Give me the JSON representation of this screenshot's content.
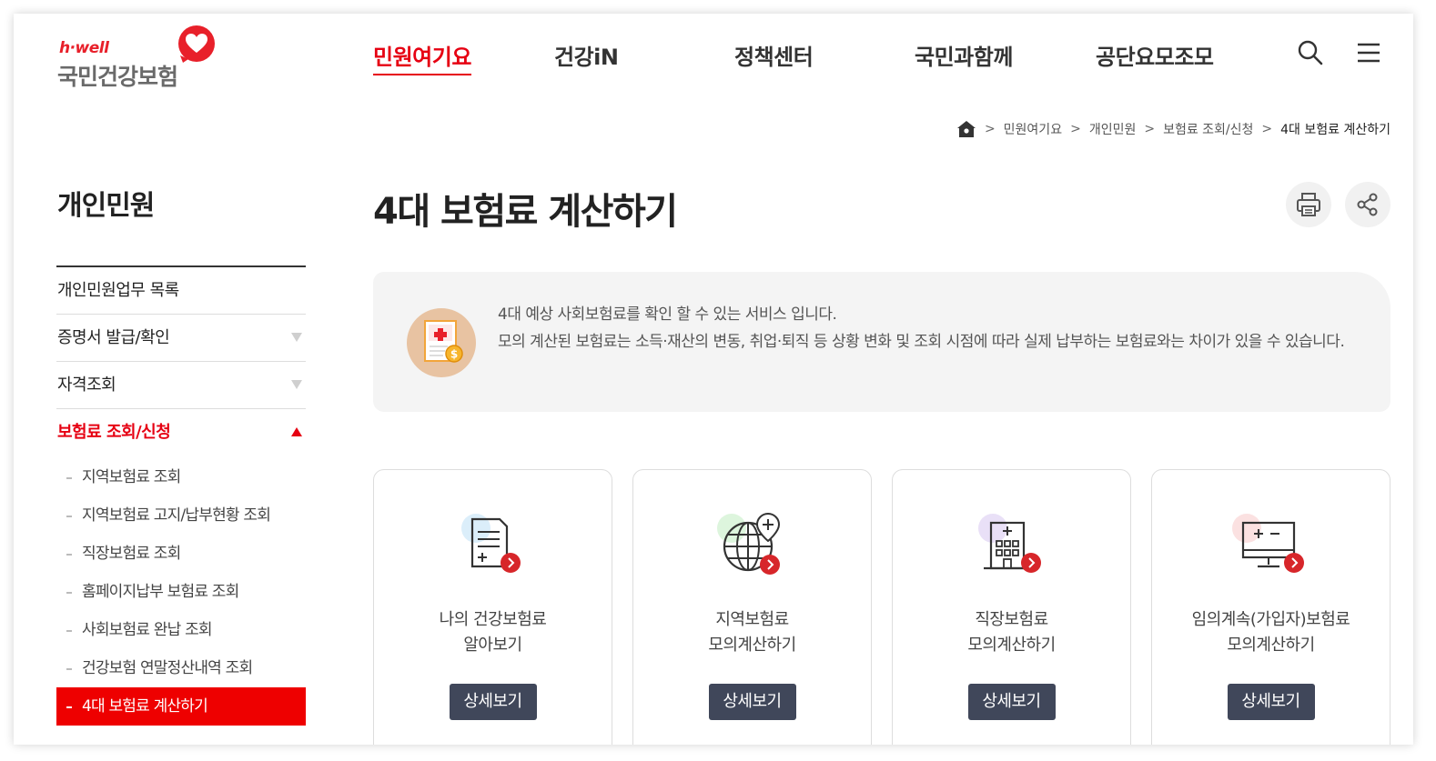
{
  "brand": {
    "tagline": "h·well",
    "name": "국민건강보험",
    "accent_color": "#e60012"
  },
  "gnb": [
    {
      "label": "민원여기요",
      "active": true
    },
    {
      "label": "건강iN",
      "active": false
    },
    {
      "label": "정책센터",
      "active": false
    },
    {
      "label": "국민과함께",
      "active": false
    },
    {
      "label": "공단요모조모",
      "active": false
    }
  ],
  "header_icons": [
    "search-icon",
    "menu-icon"
  ],
  "breadcrumb": {
    "home_icon": "home-icon",
    "items": [
      "민원여기요",
      "개인민원",
      "보험료 조회/신청",
      "4대 보험료 계산하기"
    ]
  },
  "lnb": {
    "title": "개인민원",
    "items": [
      {
        "label": "개인민원업무 목록",
        "arrow": "none"
      },
      {
        "label": "증명서 발급/확인",
        "arrow": "down"
      },
      {
        "label": "자격조회",
        "arrow": "down"
      },
      {
        "label": "보험료 조회/신청",
        "arrow": "up"
      }
    ],
    "sub_items": [
      {
        "label": "지역보험료 조회",
        "active": false
      },
      {
        "label": "지역보험료 고지/납부현황 조회",
        "active": false
      },
      {
        "label": "직장보험료 조회",
        "active": false
      },
      {
        "label": "홈페이지납부 보험료 조회",
        "active": false
      },
      {
        "label": "사회보험료 완납 조회",
        "active": false
      },
      {
        "label": "건강보험 연말정산내역 조회",
        "active": false
      },
      {
        "label": "4대 보험료 계산하기",
        "active": true
      }
    ]
  },
  "page": {
    "title": "4대 보험료 계산하기",
    "print_icon": "print-icon",
    "share_icon": "share-icon"
  },
  "info": {
    "line1": "4대 예상 사회보험료를 확인 할 수 있는 서비스 입니다.",
    "line2": "모의 계산된 보험료는 소득·재산의 변동, 취업·퇴직 등 상황 변화 및 조회 시점에 따라 실제 납부하는 보험료와는 차이가 있을 수 있습니다."
  },
  "cards": [
    {
      "line1": "나의 건강보험료",
      "line2": "알아보기",
      "button": "상세보기",
      "icon": "document-plus-icon",
      "tint": "#dbeefa"
    },
    {
      "line1": "지역보험료",
      "line2": "모의계산하기",
      "button": "상세보기",
      "icon": "globe-location-icon",
      "tint": "#ddf5dd"
    },
    {
      "line1": "직장보험료",
      "line2": "모의계산하기",
      "button": "상세보기",
      "icon": "building-icon",
      "tint": "#e9e0f7"
    },
    {
      "line1": "임의계속(가입자)보험료",
      "line2": "모의계산하기",
      "button": "상세보기",
      "icon": "monitor-calculator-icon",
      "tint": "#fbe1e1"
    }
  ]
}
